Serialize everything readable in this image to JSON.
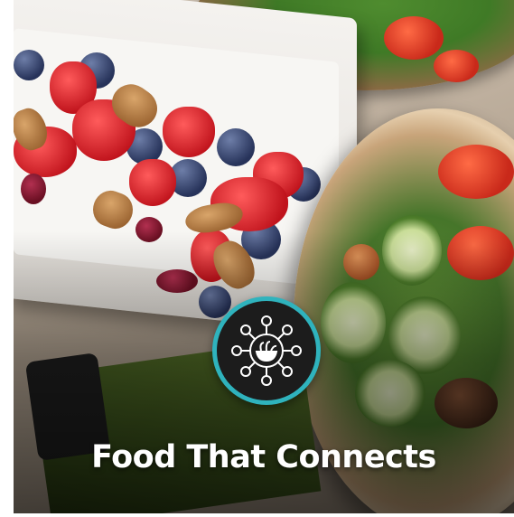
{
  "card": {
    "title": "Food That Connects",
    "accent_color": "#2fb3bd",
    "badge_color": "#1c1c1c",
    "icon": "food-network-icon"
  }
}
